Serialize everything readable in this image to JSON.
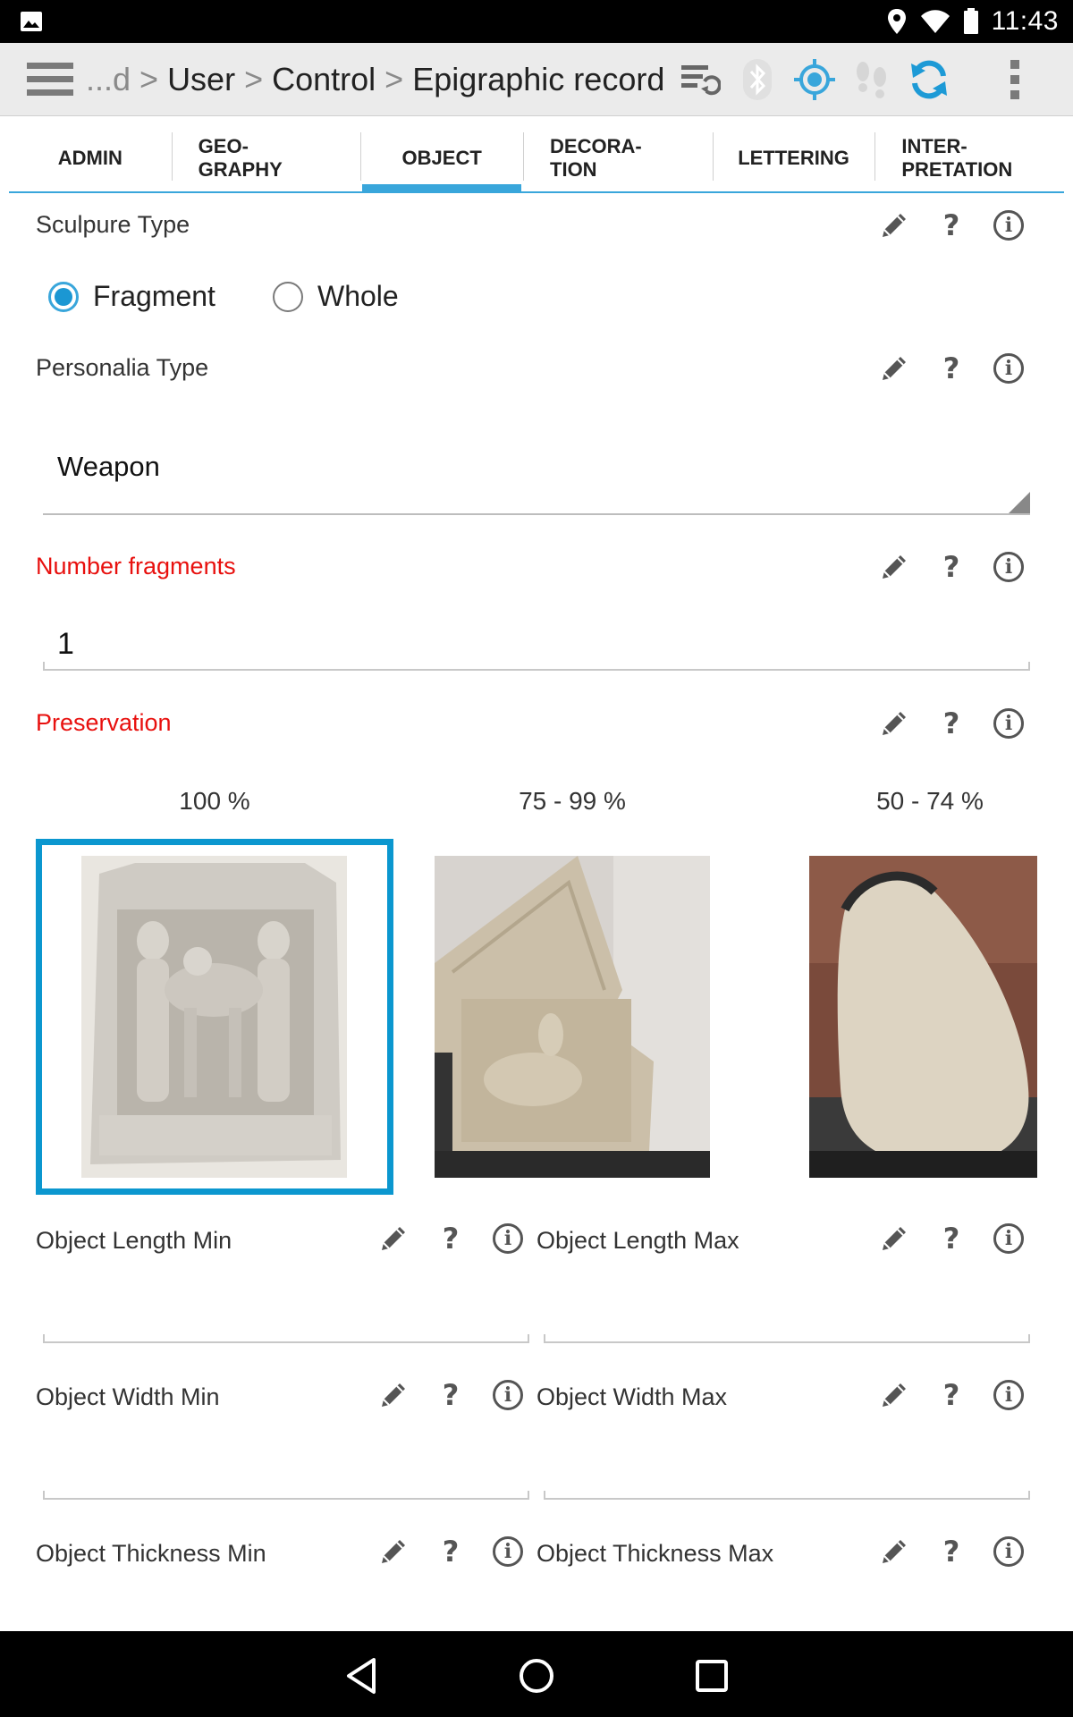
{
  "status_bar": {
    "time": "11:43",
    "icons": [
      "image-icon",
      "location-icon",
      "wifi-icon",
      "battery-icon"
    ]
  },
  "action_bar": {
    "breadcrumb_prefix": "...d",
    "breadcrumb_sep": ">",
    "crumbs": [
      "User",
      "Control",
      "Epigraphic record"
    ],
    "icons": [
      "menu-icon",
      "sync-list-icon",
      "bluetooth-icon",
      "gps-target-icon",
      "footsteps-icon",
      "refresh-icon",
      "overflow-menu-icon"
    ],
    "accent_color": "#39a6db"
  },
  "tabs": [
    {
      "label": "ADMIN",
      "active": false
    },
    {
      "label": "GEO-\nGRAPHY",
      "active": false
    },
    {
      "label": "OBJECT",
      "active": true
    },
    {
      "label": "DECORA-\nTION",
      "active": false
    },
    {
      "label": "LETTERING",
      "active": false
    },
    {
      "label": "INTER-\nPRETATION",
      "active": false
    }
  ],
  "form": {
    "sculpture_type": {
      "label": "Sculpure Type",
      "options": [
        {
          "label": "Fragment",
          "checked": true
        },
        {
          "label": "Whole",
          "checked": false
        }
      ]
    },
    "personalia_type": {
      "label": "Personalia Type",
      "value": "Weapon"
    },
    "number_fragments": {
      "label": "Number fragments",
      "value": "1",
      "required_color": "#e8100e"
    },
    "preservation": {
      "label": "Preservation",
      "options": [
        {
          "label": "100 %",
          "selected": true
        },
        {
          "label": "75 - 99 %",
          "selected": false
        },
        {
          "label": "50 - 74 %",
          "selected": false
        }
      ]
    },
    "object_length_min": {
      "label": "Object Length Min",
      "value": ""
    },
    "object_length_max": {
      "label": "Object Length Max",
      "value": ""
    },
    "object_width_min": {
      "label": "Object Width Min",
      "value": ""
    },
    "object_width_max": {
      "label": "Object Width Max",
      "value": ""
    },
    "object_thickness_min": {
      "label": "Object Thickness Min"
    },
    "object_thickness_max": {
      "label": "Object Thickness Max"
    }
  },
  "field_tools": {
    "edit": "pencil-icon",
    "help": "?",
    "info": "i"
  },
  "nav_bar": {
    "icons": [
      "back-icon",
      "home-icon",
      "recents-icon"
    ]
  }
}
